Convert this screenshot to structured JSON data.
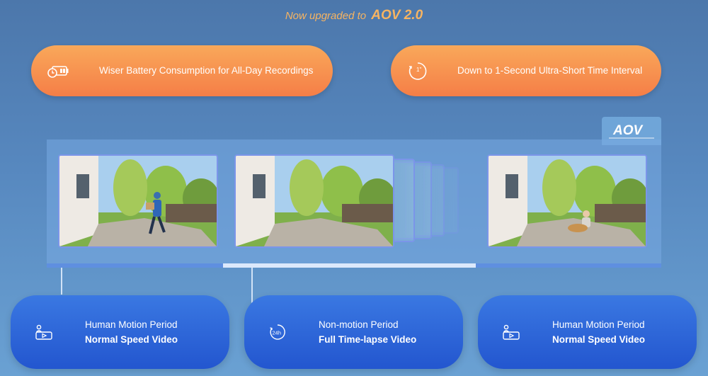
{
  "headline": {
    "prefix": "Now upgraded to",
    "brand": "AOV 2.0"
  },
  "features": [
    {
      "label": "Wiser Battery Consumption for All-Day Recordings",
      "icon": "battery-clock-icon"
    },
    {
      "label": "Down to 1-Second Ultra-Short Time Interval",
      "icon": "stopwatch-icon",
      "icon_text": "1\""
    }
  ],
  "badge": {
    "logo": "AOV",
    "icon": "aov-logo-icon"
  },
  "frames": [
    {
      "scene": "courier walking with package",
      "icon": "courier-scene"
    },
    {
      "scene": "empty garden path",
      "icon": "empty-garden-scene"
    },
    {
      "scene": "person with dog on lawn",
      "icon": "dog-scene"
    }
  ],
  "modes": [
    {
      "title": "Human Motion Period",
      "subtitle": "Normal Speed Video",
      "icon": "person-video-icon"
    },
    {
      "title": "Non-motion Period",
      "subtitle": "Full Time-lapse Video",
      "icon": "24h-clock-icon",
      "icon_text": "24h"
    },
    {
      "title": "Human Motion Period",
      "subtitle": "Normal Speed Video",
      "icon": "person-video-icon"
    }
  ],
  "colors": {
    "accent_orange": "#f7b461",
    "pill_orange": "#f57e47",
    "card_blue": "#2356cf",
    "frame_border": "#7b95e9"
  }
}
